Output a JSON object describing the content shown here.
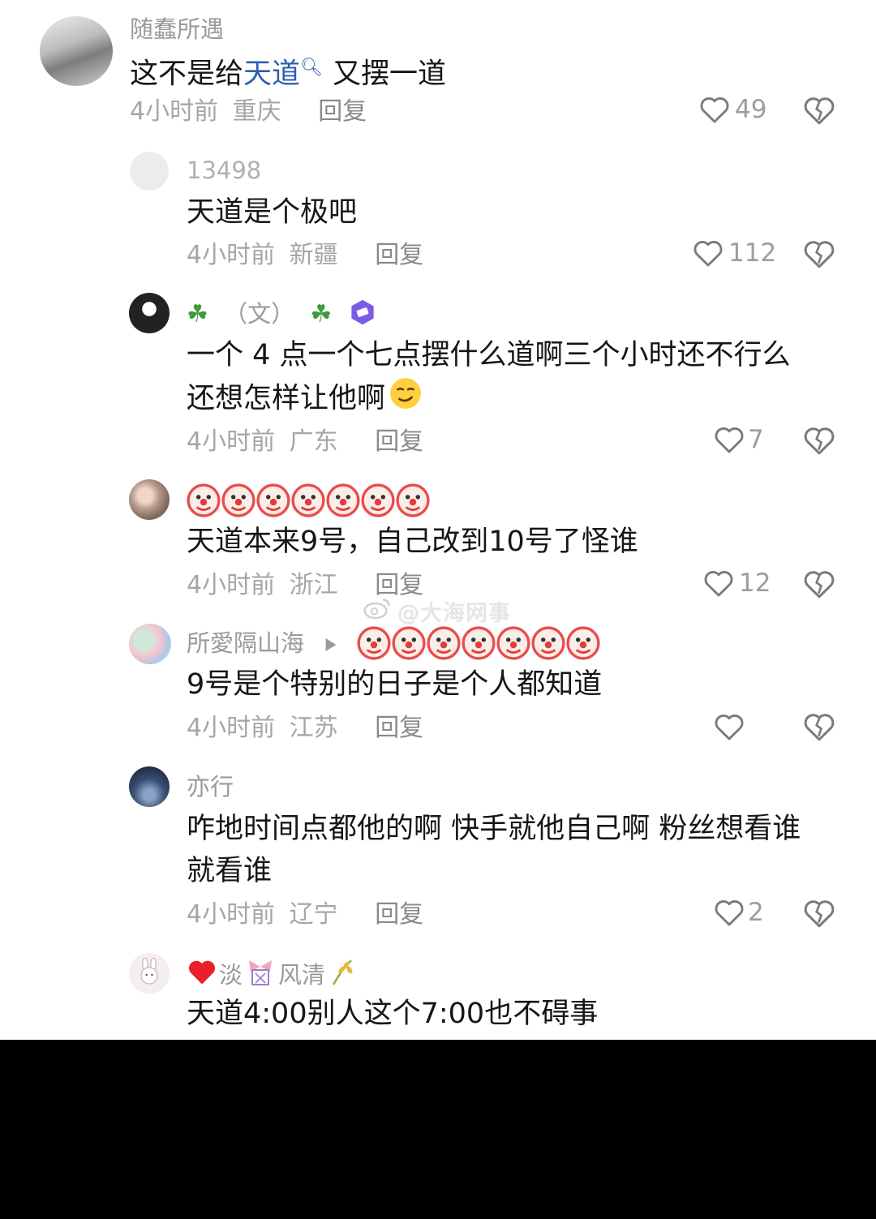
{
  "colors": {
    "background": "#ffffff",
    "outer": "#000000",
    "link": "#2c5fae",
    "meta": "#a6a6a6"
  },
  "comments": [
    {
      "username": "随蠢所遇",
      "text_before": "这不是给",
      "text_link": "天道",
      "text_after": "又摆一道",
      "time": "4小时前",
      "location": "重庆",
      "reply": "回复",
      "likes": "49"
    },
    {
      "username": "13498",
      "text": "天道是个极吧",
      "time": "4小时前",
      "location": "新疆",
      "reply": "回复",
      "likes": "112"
    },
    {
      "username": "（文）",
      "text_line1": "一个 4 点一个七点摆什么道啊三个小时还不行么",
      "text_line2": "还想怎样让他啊",
      "time": "4小时前",
      "location": "广东",
      "reply": "回复",
      "likes": "7"
    },
    {
      "text": "天道本来9号，自己改到10号了怪谁",
      "time": "4小时前",
      "location": "浙江",
      "reply": "回复",
      "likes": "12"
    },
    {
      "username": "所愛隔山海",
      "text": "9号是个特别的日子是个人都知道",
      "time": "4小时前",
      "location": "江苏",
      "reply": "回复",
      "likes": ""
    },
    {
      "username": "亦行",
      "text_line1": "咋地时间点都他的啊 快手就他自己啊 粉丝想看谁",
      "text_line2": "就看谁",
      "time": "4小时前",
      "location": "辽宁",
      "reply": "回复",
      "likes": "2"
    },
    {
      "username_part1": "淡",
      "username_part2": "风清",
      "text": "天道4:00别人这个7:00也不碍事"
    }
  ],
  "watermark": "@大海网事",
  "icons": {
    "like": "heart-outline-icon",
    "dislike": "broken-heart-icon",
    "search": "search-icon",
    "play": "play-arrow-icon"
  }
}
